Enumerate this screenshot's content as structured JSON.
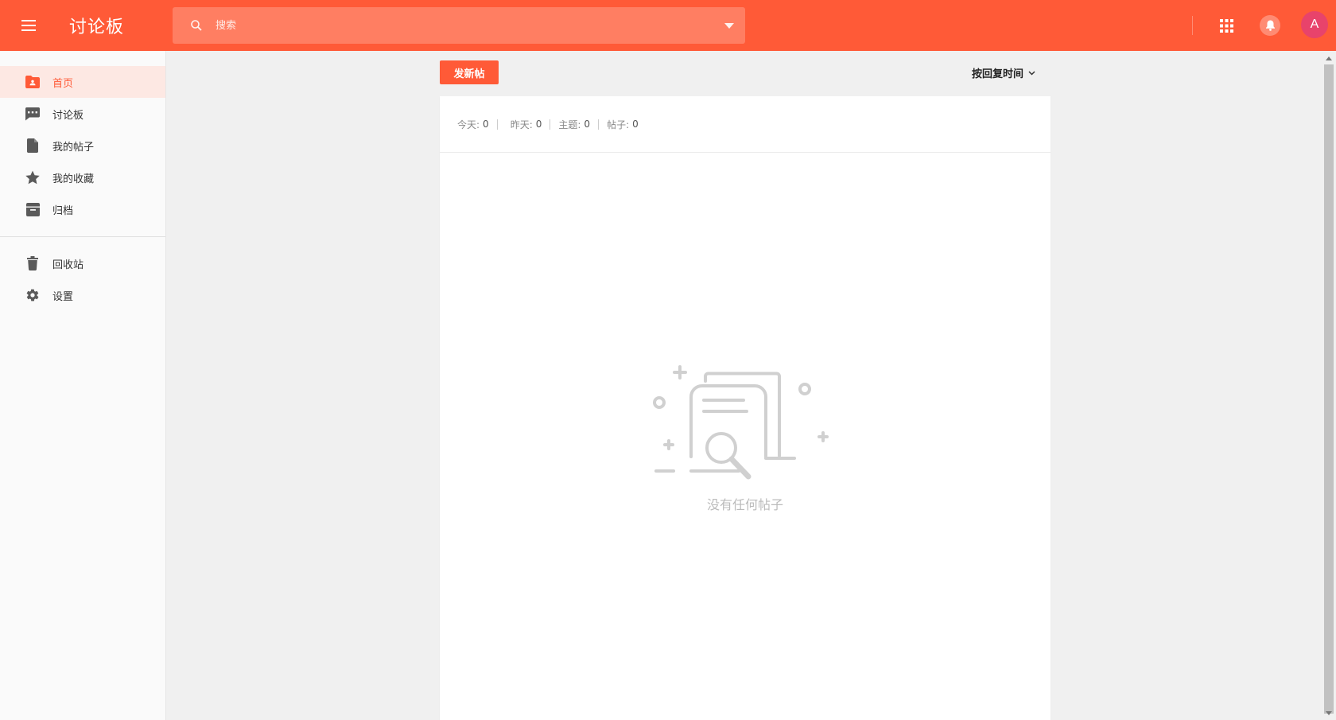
{
  "header": {
    "title": "讨论板",
    "search": {
      "placeholder": "搜索",
      "value": ""
    },
    "avatar_letter": "A",
    "icons": {
      "menu": "hamburger-menu-icon",
      "search": "search-icon",
      "dropdown": "triangle-down-icon",
      "apps": "apps-grid-icon",
      "notifications": "bell-icon"
    }
  },
  "sidebar": {
    "items": [
      {
        "label": "首页",
        "icon": "home-folder-icon",
        "active": true
      },
      {
        "label": "讨论板",
        "icon": "forum-icon",
        "active": false
      },
      {
        "label": "我的帖子",
        "icon": "document-icon",
        "active": false
      },
      {
        "label": "我的收藏",
        "icon": "star-icon",
        "active": false
      },
      {
        "label": "归档",
        "icon": "archive-icon",
        "active": false
      }
    ],
    "items_bottom": [
      {
        "label": "回收站",
        "icon": "trash-icon"
      },
      {
        "label": "设置",
        "icon": "gear-icon"
      }
    ]
  },
  "toolbar": {
    "new_post_label": "发新帖",
    "sort_label": "按回复时间"
  },
  "stats": [
    {
      "label": "今天:",
      "value": "0"
    },
    {
      "label": "昨天:",
      "value": "0"
    },
    {
      "label": "主题:",
      "value": "0"
    },
    {
      "label": "帖子:",
      "value": "0"
    }
  ],
  "empty_state": {
    "text": "没有任何帖子"
  },
  "colors": {
    "accent": "#ff5a37",
    "active_bg": "#fde8e3",
    "avatar_bg": "#e8436b",
    "icon_gray": "#5a5a5a",
    "empty_illustration": "#d0d0d0"
  }
}
